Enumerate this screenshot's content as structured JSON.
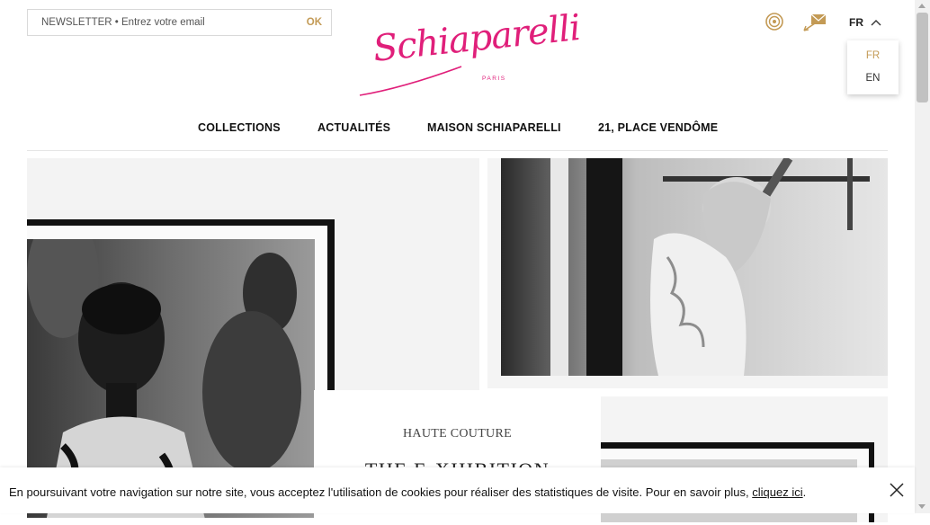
{
  "header": {
    "newsletter": {
      "placeholder": "NEWSLETTER • Entrez votre email",
      "submit_label": "OK"
    },
    "logo": {
      "brand": "Schiaparelli",
      "city": "PARIS"
    },
    "icons": [
      "store-locator-icon",
      "mail-icon"
    ],
    "language": {
      "current": "FR",
      "options": [
        "FR",
        "EN"
      ]
    }
  },
  "nav": {
    "items": [
      "COLLECTIONS",
      "ACTUALITÉS",
      "MAISON SCHIAPARELLI",
      "21, PLACE VENDÔME"
    ]
  },
  "feature": {
    "category": "HAUTE COUTURE",
    "title": "THE E-XHIBITION"
  },
  "cookie_banner": {
    "text": "En poursuivant votre navigation sur notre site, vous acceptez l'utilisation de cookies pour réaliser des statistiques de visite. Pour en savoir plus, ",
    "link": "cliquez ici",
    "suffix": "."
  },
  "colors": {
    "accent_gold": "#c39a55",
    "brand_pink": "#e01f7a"
  }
}
